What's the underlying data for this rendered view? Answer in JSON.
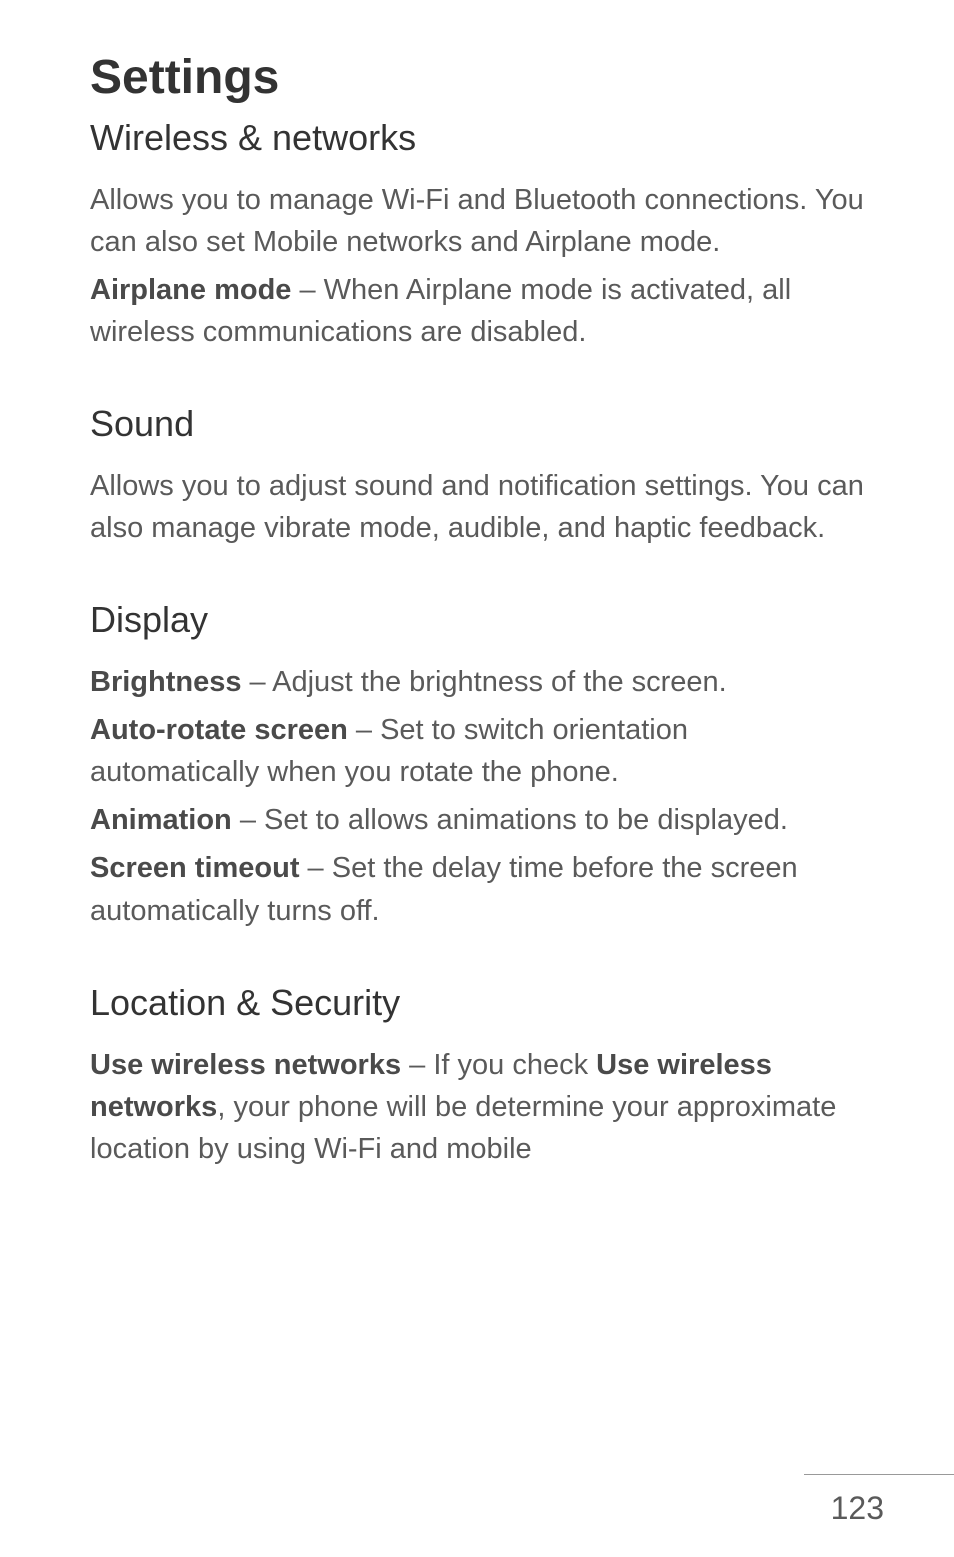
{
  "title": "Settings",
  "sections": {
    "wireless": {
      "heading": "Wireless & networks",
      "intro": "Allows you to manage Wi-Fi and Bluetooth connections. You can also set Mobile networks and Airplane mode.",
      "airplane_label": "Airplane mode",
      "airplane_text": " – When Airplane mode is activated, all wireless communications are disabled."
    },
    "sound": {
      "heading": "Sound",
      "text": "Allows you to adjust sound and notification settings. You can also manage vibrate mode, audible, and haptic feedback."
    },
    "display": {
      "heading": "Display",
      "brightness_label": "Brightness",
      "brightness_text": " – Adjust the brightness of the screen.",
      "autorotate_label": "Auto-rotate screen",
      "autorotate_text": " – Set to switch orientation automatically when you rotate the phone.",
      "animation_label": "Animation",
      "animation_text": " – Set to allows animations to be displayed.",
      "timeout_label": "Screen timeout",
      "timeout_text": " – Set the delay time before the screen automatically turns off."
    },
    "location": {
      "heading": "Location & Security",
      "wireless_label": "Use wireless networks",
      "wireless_mid": " – If you check ",
      "wireless_label2": "Use wireless networks",
      "wireless_text": ", your phone will be determine your approximate location by using Wi-Fi and mobile"
    }
  },
  "page_number": "123"
}
